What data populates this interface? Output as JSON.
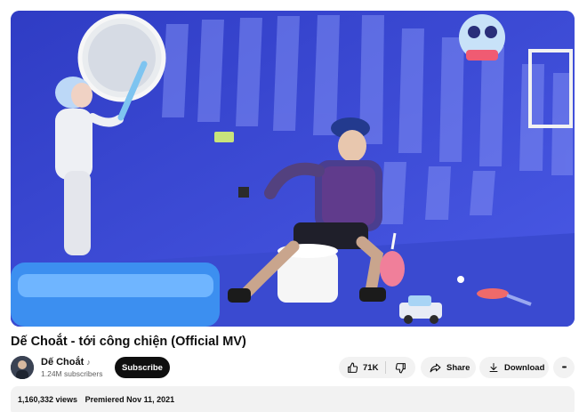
{
  "video": {
    "title": "Dế Choắt - tới công chiện (Official MV)"
  },
  "channel": {
    "name": "Dế Choắt",
    "verified_icon": "music-note-icon",
    "verified_glyph": "♪",
    "subscribers": "1.24M subscribers",
    "subscribe_label": "Subscribe"
  },
  "actions": {
    "like_count": "71K",
    "share_label": "Share",
    "download_label": "Download",
    "more_glyph": "•••"
  },
  "description": {
    "views": "1,160,332 views",
    "premiered": "Premiered Nov 11, 2021"
  },
  "colors": {
    "wall": "#3c49d6",
    "subscribe_bg": "#0f0f0f",
    "pill_bg": "#f2f2f2"
  }
}
